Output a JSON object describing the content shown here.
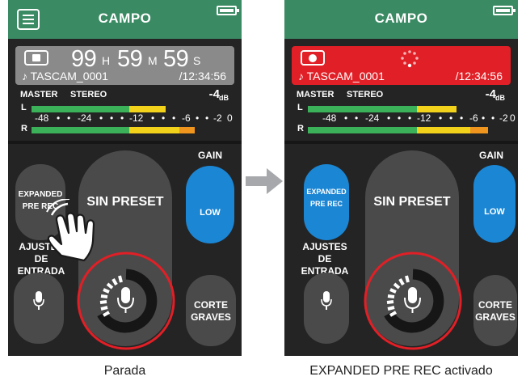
{
  "left": {
    "title": "CAMPO",
    "time": {
      "hours": "99",
      "h_unit": "H",
      "minutes": "59",
      "m_unit": "M",
      "seconds": "59",
      "s_unit": "S"
    },
    "file_name": "♪ TASCAM_0001",
    "total_time": "/12:34:56",
    "meter": {
      "master": "MASTER",
      "stereo": "STEREO",
      "level": "-4",
      "unit": "dB",
      "left": "L",
      "right": "R",
      "scale": [
        "-48",
        "•",
        "•",
        "-24",
        "•",
        "•",
        "•",
        "-12",
        "•",
        "•",
        "•",
        "-6",
        "•",
        "•",
        "-2",
        "0"
      ]
    },
    "expanded_label": "EXPANDED\nPRE REC",
    "expanded_active": false,
    "preset": "SIN PRESET",
    "gain_label": "GAIN",
    "gain_value": "LOW",
    "ajustes": "AJUSTES DE\nENTRADA",
    "corte": "CORTE\nGRAVES",
    "caption": "Parada"
  },
  "right": {
    "title": "CAMPO",
    "file_name": "♪ TASCAM_0001",
    "total_time": "/12:34:56",
    "meter": {
      "master": "MASTER",
      "stereo": "STEREO",
      "level": "-4",
      "unit": "dB",
      "left": "L",
      "right": "R",
      "scale": [
        "-48",
        "•",
        "•",
        "-24",
        "•",
        "•",
        "•",
        "-12",
        "•",
        "•",
        "•",
        "-6",
        "•",
        "•",
        "-2",
        "0"
      ]
    },
    "expanded_label": "EXPANDED\nPRE REC",
    "expanded_active": true,
    "preset": "SIN PRESET",
    "gain_label": "GAIN",
    "gain_value": "LOW",
    "ajustes": "AJUSTES DE\nENTRADA",
    "corte": "CORTE\nGRAVES",
    "caption": "EXPANDED PRE REC activado"
  },
  "colors": {
    "title_bar": "#3a8a63",
    "recording": "#e11f26",
    "active_blue": "#1b86d4",
    "meter_green": "#3bb15a",
    "meter_yellow": "#f3d21b",
    "meter_orange": "#f0961e"
  },
  "icons": [
    "menu-icon",
    "battery-icon",
    "stop-icon",
    "record-icon",
    "loading-spinner-icon",
    "microphone-icon",
    "hand-pointer-icon",
    "arrow-right-icon"
  ]
}
